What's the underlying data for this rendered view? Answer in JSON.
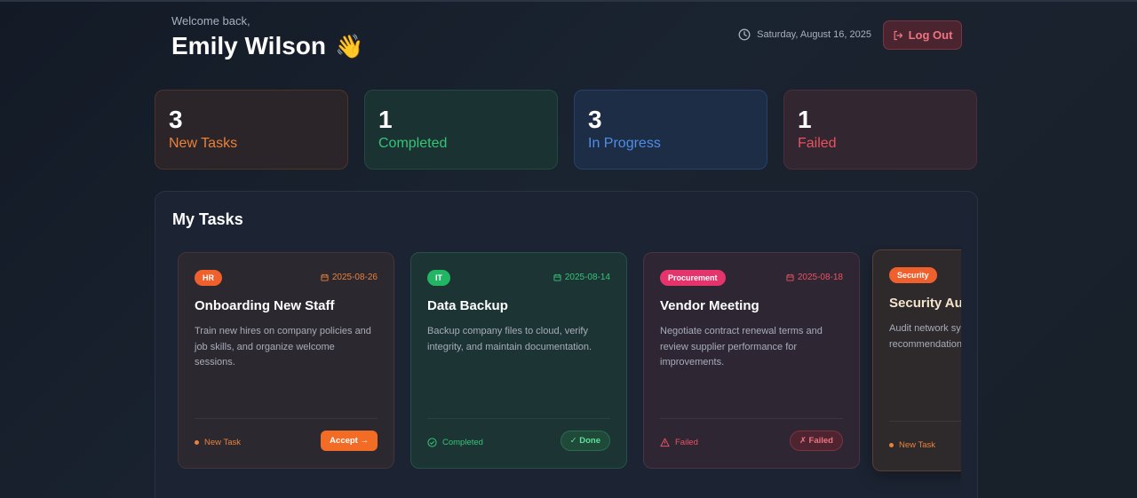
{
  "header": {
    "welcome": "Welcome back,",
    "user_name": "Emily Wilson",
    "wave_emoji": "👋",
    "date": "Saturday, August 16, 2025",
    "logout_label": "Log Out"
  },
  "stats": [
    {
      "count": "3",
      "label": "New Tasks",
      "color": "#e9823b"
    },
    {
      "count": "1",
      "label": "Completed",
      "color": "#36c477"
    },
    {
      "count": "3",
      "label": "In Progress",
      "color": "#4e8ee8"
    },
    {
      "count": "1",
      "label": "Failed",
      "color": "#ea5260"
    }
  ],
  "tasks_panel": {
    "title": "My Tasks",
    "tasks": [
      {
        "category": "HR",
        "date": "2025-08-26",
        "title": "Onboarding New Staff",
        "description": "Train new hires on company policies and job skills, and organize welcome sessions.",
        "status": "New Task",
        "action": "Accept →"
      },
      {
        "category": "IT",
        "date": "2025-08-14",
        "title": "Data Backup",
        "description": "Backup company files to cloud, verify integrity, and maintain documentation.",
        "status": "Completed",
        "action": "✓ Done"
      },
      {
        "category": "Procurement",
        "date": "2025-08-18",
        "title": "Vendor Meeting",
        "description": "Negotiate contract renewal terms and review supplier performance for improvements.",
        "status": "Failed",
        "action": "✗ Failed"
      },
      {
        "category": "Security",
        "title": "Security Au",
        "description": "Audit network sy and prepare a re recommendation",
        "status": "New Task"
      }
    ]
  },
  "colors": {
    "accent_orange": "#f26c26",
    "accent_green": "#36c477",
    "accent_blue": "#4e8ee8",
    "accent_red": "#ea5260"
  }
}
